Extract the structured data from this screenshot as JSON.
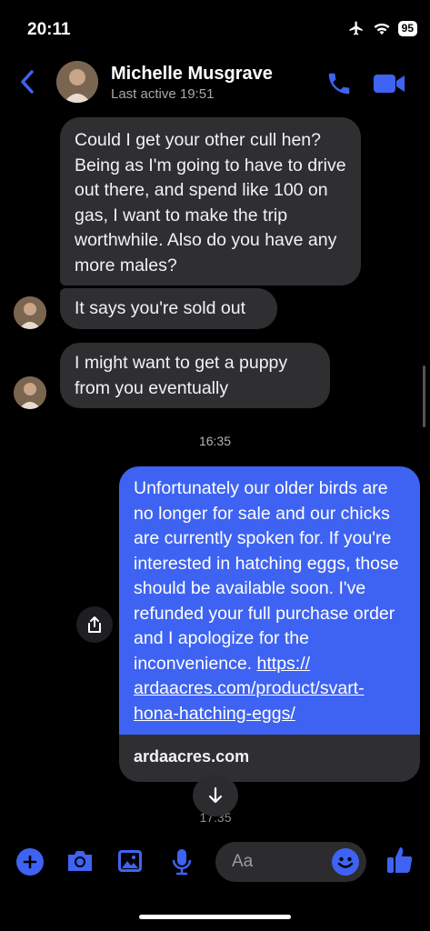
{
  "status": {
    "time": "20:11",
    "battery": "95"
  },
  "header": {
    "name": "Michelle Musgrave",
    "subtitle": "Last active 19:51"
  },
  "messages": {
    "in1": "Could I get your other cull hen? Being as I'm going to have to drive out there, and spend like 100 on gas, I want to make the trip worthwhile. Also do you have any more males?",
    "in2": "It says you're sold out",
    "in3": "I might want to get a puppy from you eventually",
    "time": "16:35",
    "out_text": "Unfortunately our older birds are no longer for sale and our chicks are currently spoken for. If you're interested in hatching eggs, those should be available soon. I've refunded your full purchase order and I apologize for the inconvenience. ",
    "out_link": "https://​ardaacres.com/product/svart-​hona-hatching-eggs/",
    "preview_domain": "ardaacres.com",
    "peek_time": "17:35"
  },
  "composer": {
    "placeholder": "Aa"
  },
  "colors": {
    "accent": "#3e63f2",
    "bubble_in": "#2f2f32",
    "background": "#000000"
  }
}
